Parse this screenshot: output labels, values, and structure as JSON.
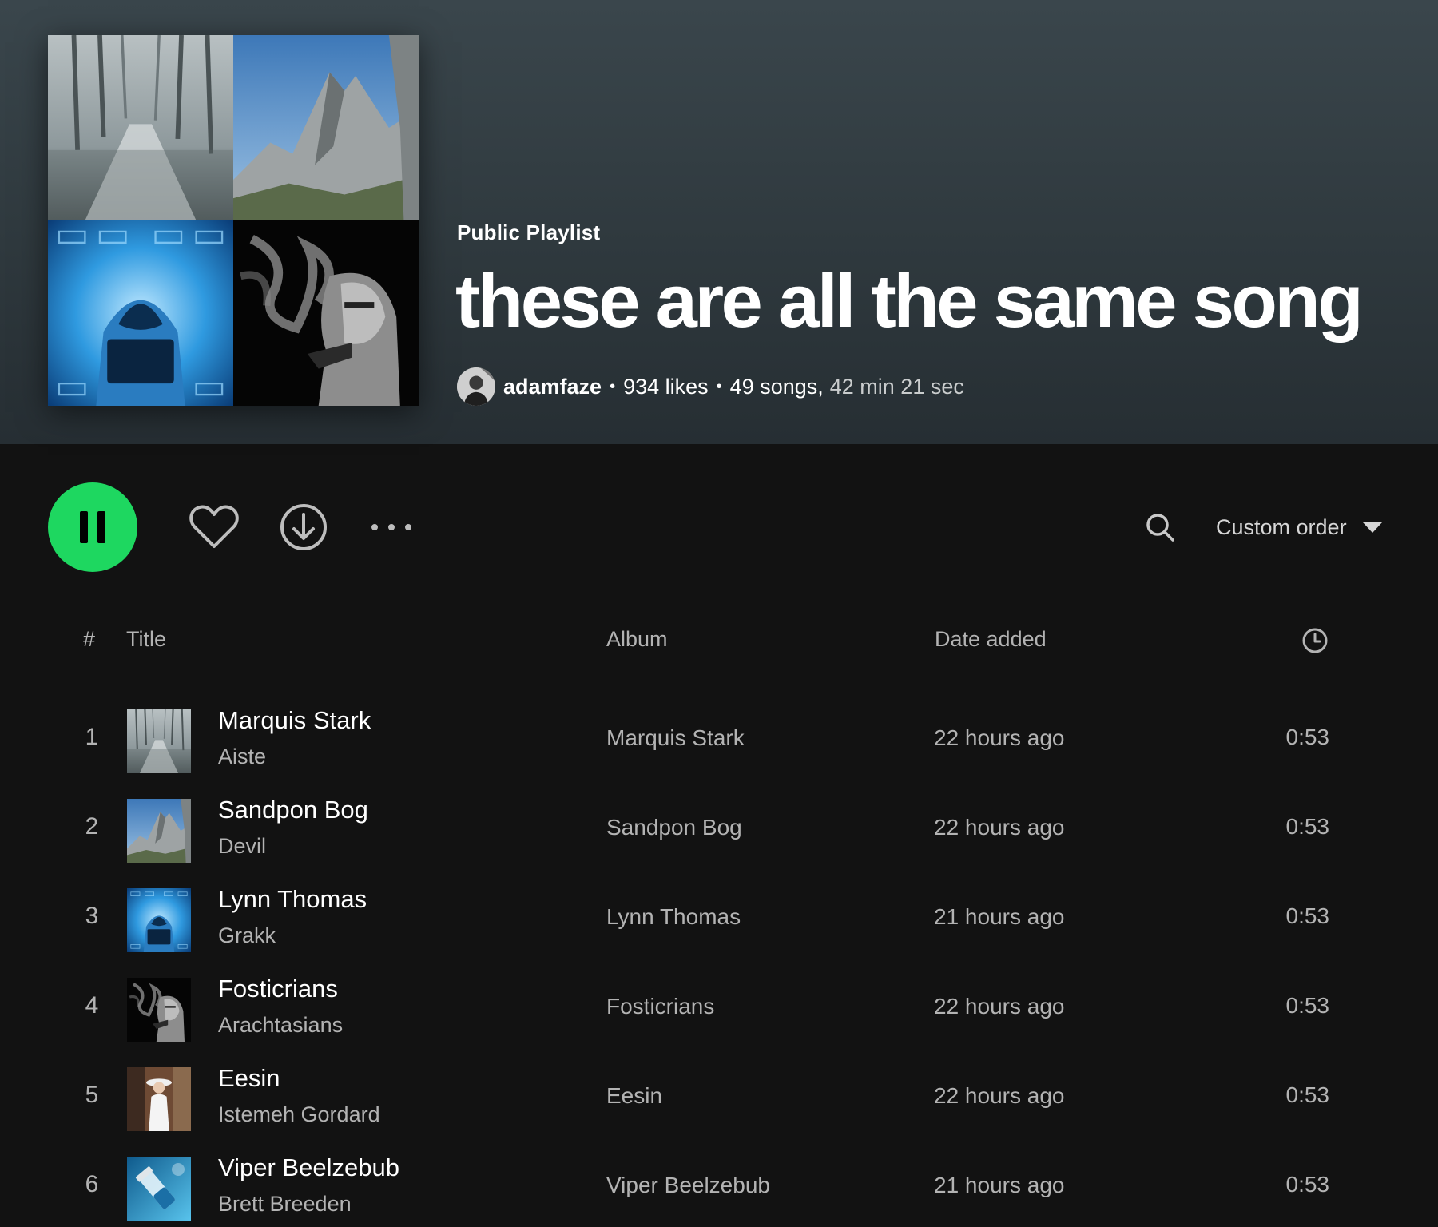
{
  "playlist": {
    "kind": "Public Playlist",
    "title": "these are all the same song",
    "owner": "adamfaze",
    "likes": "934 likes",
    "songs": "49 songs,",
    "duration": "42 min 21 sec"
  },
  "controls": {
    "play_state": "playing",
    "sort_label": "Custom order",
    "icons": [
      "pause-icon",
      "heart-icon",
      "download-icon",
      "more-icon",
      "search-icon",
      "caret-down-icon",
      "clock-icon"
    ]
  },
  "table": {
    "headers": {
      "num": "#",
      "title": "Title",
      "album": "Album",
      "date_added": "Date added"
    },
    "rows": [
      {
        "num": "1",
        "title": "Marquis Stark",
        "artist": "Aiste",
        "album": "Marquis Stark",
        "date_added": "22 hours ago",
        "duration": "0:53"
      },
      {
        "num": "2",
        "title": "Sandpon Bog",
        "artist": "Devil",
        "album": "Sandpon Bog",
        "date_added": "22 hours ago",
        "duration": "0:53"
      },
      {
        "num": "3",
        "title": "Lynn Thomas",
        "artist": "Grakk",
        "album": "Lynn Thomas",
        "date_added": "21 hours ago",
        "duration": "0:53"
      },
      {
        "num": "4",
        "title": "Fosticrians",
        "artist": "Arachtasians",
        "album": "Fosticrians",
        "date_added": "22 hours ago",
        "duration": "0:53"
      },
      {
        "num": "5",
        "title": "Eesin",
        "artist": "Istemeh Gordard",
        "album": "Eesin",
        "date_added": "22 hours ago",
        "duration": "0:53"
      },
      {
        "num": "6",
        "title": "Viper Beelzebub",
        "artist": "Brett Breeden",
        "album": "Viper Beelzebub",
        "date_added": "21 hours ago",
        "duration": "0:53"
      }
    ]
  },
  "colors": {
    "accent": "#1ed760",
    "background": "#121212",
    "header_top": "#3a464c",
    "secondary_text": "#b3b3b3"
  }
}
